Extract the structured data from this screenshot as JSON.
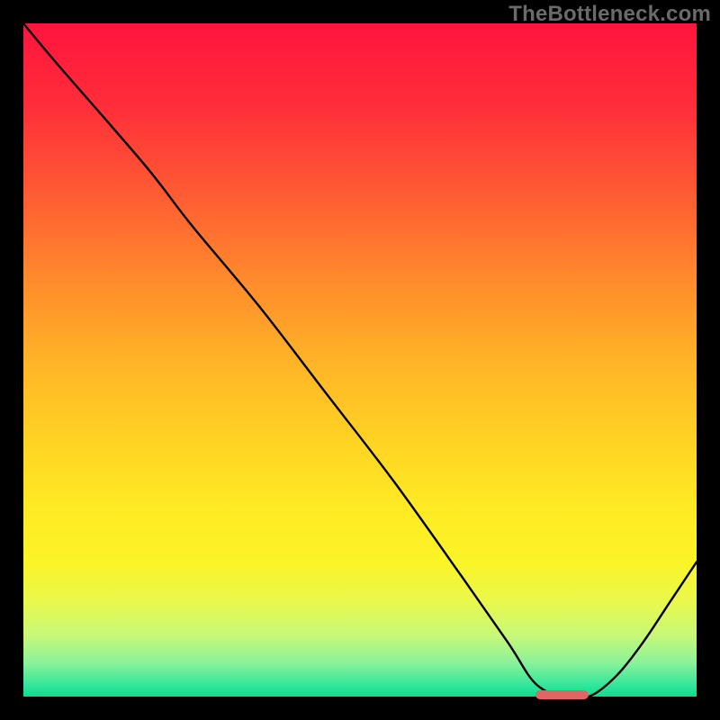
{
  "watermark": "TheBottleneck.com",
  "chart_data": {
    "type": "line",
    "title": "",
    "xlabel": "",
    "ylabel": "",
    "xlim": [
      0,
      100
    ],
    "ylim": [
      0,
      100
    ],
    "x": [
      0,
      5,
      18,
      25,
      35,
      45,
      55,
      65,
      72,
      76,
      80,
      84,
      88,
      92,
      96,
      100
    ],
    "values": [
      100,
      94,
      79,
      70,
      58,
      45,
      32,
      18,
      8,
      2,
      0,
      0,
      3,
      8,
      14,
      20
    ],
    "gradient_stops": [
      {
        "offset": 0.0,
        "color": "#ff143c"
      },
      {
        "offset": 0.12,
        "color": "#ff2d3a"
      },
      {
        "offset": 0.25,
        "color": "#ff5a33"
      },
      {
        "offset": 0.38,
        "color": "#ff8a2c"
      },
      {
        "offset": 0.5,
        "color": "#ffb327"
      },
      {
        "offset": 0.62,
        "color": "#ffd324"
      },
      {
        "offset": 0.72,
        "color": "#ffea24"
      },
      {
        "offset": 0.8,
        "color": "#fbf427"
      },
      {
        "offset": 0.86,
        "color": "#e9f84d"
      },
      {
        "offset": 0.91,
        "color": "#c6f879"
      },
      {
        "offset": 0.95,
        "color": "#8af29a"
      },
      {
        "offset": 0.985,
        "color": "#2de59a"
      },
      {
        "offset": 1.0,
        "color": "#10d98f"
      }
    ],
    "marker": {
      "x_center": 80,
      "width_pct": 8,
      "y": 0,
      "color": "#e06666"
    }
  }
}
